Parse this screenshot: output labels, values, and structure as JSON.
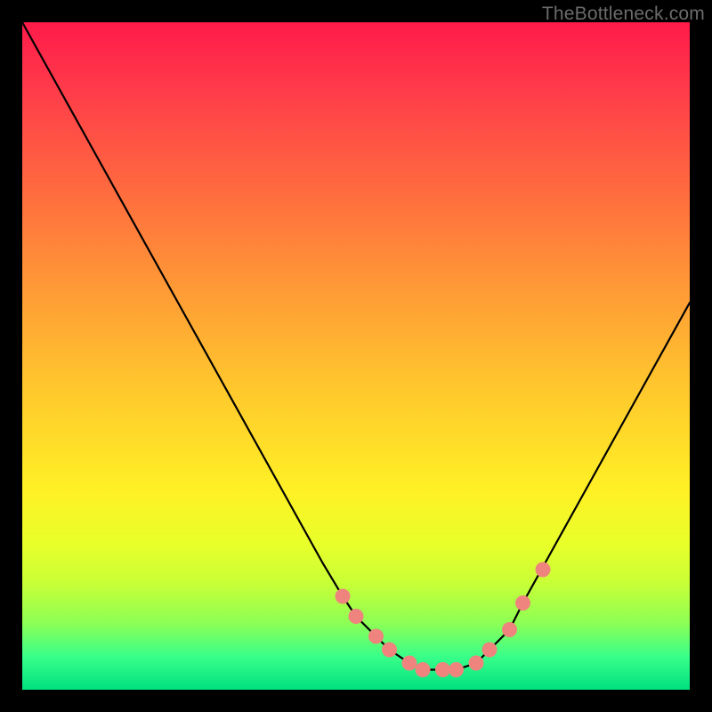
{
  "watermark": "TheBottleneck.com",
  "chart_data": {
    "type": "line",
    "title": "",
    "xlabel": "",
    "ylabel": "",
    "xlim": [
      0,
      100
    ],
    "ylim": [
      0,
      100
    ],
    "series": [
      {
        "name": "curve",
        "x": [
          0,
          5,
          10,
          15,
          20,
          25,
          30,
          35,
          40,
          45,
          48,
          50,
          53,
          55,
          58,
          60,
          63,
          65,
          68,
          70,
          73,
          75,
          80,
          85,
          90,
          95,
          100
        ],
        "y": [
          100,
          91,
          82,
          73,
          64,
          55,
          46,
          37,
          28,
          19,
          14,
          11,
          8,
          6,
          4,
          3,
          3,
          3,
          4,
          6,
          9,
          13,
          22,
          31,
          40,
          49,
          58
        ]
      }
    ],
    "markers": [
      {
        "x": 48,
        "y": 14
      },
      {
        "x": 50,
        "y": 11
      },
      {
        "x": 53,
        "y": 8
      },
      {
        "x": 55,
        "y": 6
      },
      {
        "x": 58,
        "y": 4
      },
      {
        "x": 60,
        "y": 3
      },
      {
        "x": 63,
        "y": 3
      },
      {
        "x": 65,
        "y": 3
      },
      {
        "x": 68,
        "y": 4
      },
      {
        "x": 70,
        "y": 6
      },
      {
        "x": 73,
        "y": 9
      },
      {
        "x": 75,
        "y": 13
      },
      {
        "x": 78,
        "y": 18
      }
    ],
    "colors": {
      "curve_stroke": "#000000",
      "marker_fill": "#ee847d",
      "gradient_top": "#ff1a4a",
      "gradient_mid": "#fff025",
      "gradient_bottom": "#00e080"
    }
  }
}
